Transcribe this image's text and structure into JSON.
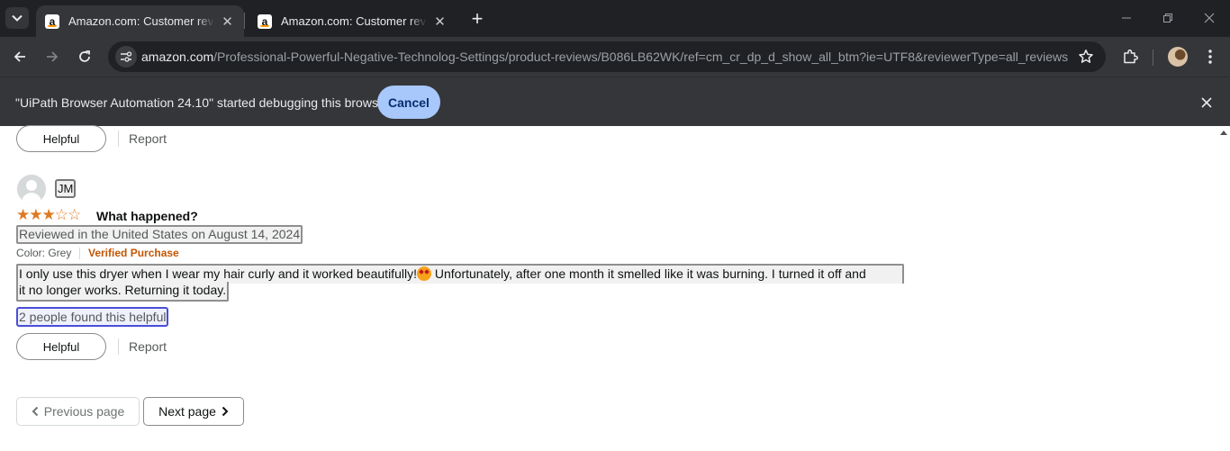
{
  "browser": {
    "tabs": [
      {
        "title": "Amazon.com: Customer reviews",
        "favicon": "a",
        "active": true
      },
      {
        "title": "Amazon.com: Customer reviews",
        "favicon": "a",
        "active": false
      }
    ],
    "url_host": "amazon.com",
    "url_path": "/Professional-Powerful-Negative-Technolog-Settings/product-reviews/B086LB62WK/ref=cm_cr_dp_d_show_all_btm?ie=UTF8&reviewerType=all_reviews",
    "icons": [
      "tab-search-icon",
      "close-icon",
      "new-tab-icon",
      "minimize-icon",
      "restore-icon",
      "back-arrow-icon",
      "forward-arrow-icon",
      "reload-icon",
      "site-info-icon",
      "bookmark-star-icon",
      "extensions-icon",
      "kebab-menu-icon"
    ]
  },
  "infobar": {
    "message": "\"UiPath Browser Automation 24.10\" started debugging this browser",
    "cancel_label": "Cancel"
  },
  "previous_review": {
    "helpful_label": "Helpful",
    "report_label": "Report"
  },
  "review": {
    "reviewer_name": "JM",
    "rating": 3,
    "rating_max": 5,
    "title": "What happened?",
    "date": "Reviewed in the United States on August 14, 2024",
    "variant": "Color: Grey",
    "verified": "Verified Purchase",
    "body_line1_before_emoji": "I only use this dryer when I wear my hair curly and it worked beautifully!",
    "body_line1_after_emoji": " Unfortunately, after one month it smelled like it was burning. I turned it off and",
    "body_line2": "it no longer works. Returning it today.",
    "helpful_count": "2 people found this helpful",
    "helpful_label": "Helpful",
    "report_label": "Report"
  },
  "pagination": {
    "previous_label": "Previous page",
    "next_label": "Next page"
  },
  "colors": {
    "star": "#de7921",
    "verified": "#c45500",
    "infobar_button": "#a8c7fa"
  }
}
